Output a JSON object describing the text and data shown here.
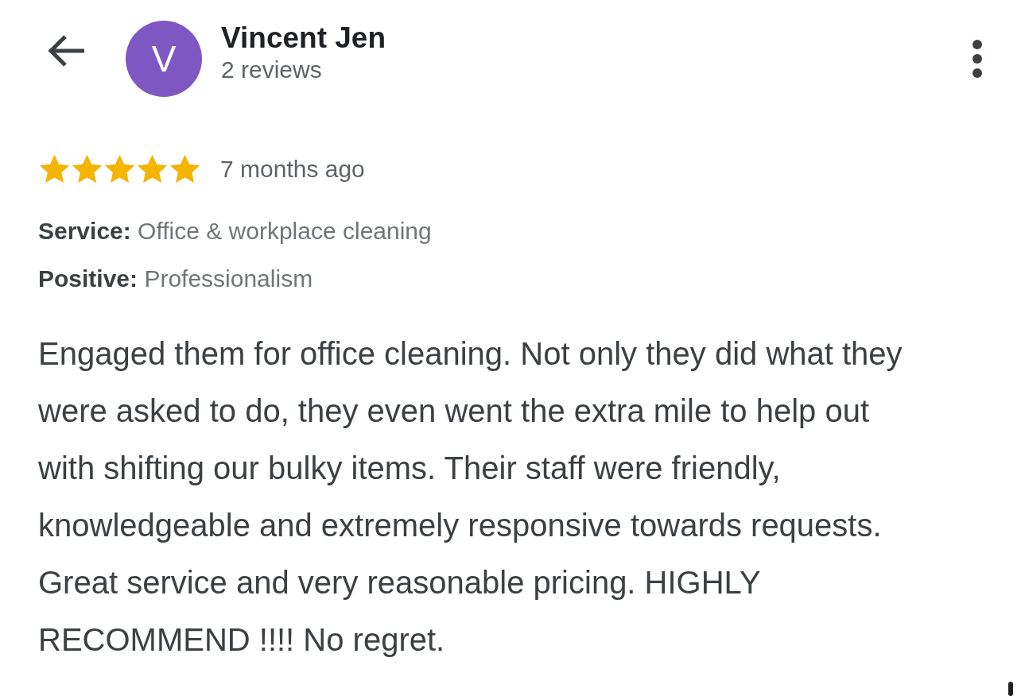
{
  "reviewer": {
    "initial": "V",
    "name": "Vincent Jen",
    "review_count": "2 reviews"
  },
  "review": {
    "stars": 5,
    "time": "7 months ago",
    "attributes": [
      {
        "label": "Service:",
        "value": "Office & workplace cleaning"
      },
      {
        "label": "Positive:",
        "value": "Professionalism"
      }
    ],
    "text": "Engaged them for office cleaning. Not only they did what they were asked to do, they even went the extra mile to help out with shifting our bulky items. Their staff were friendly, knowledgeable and extremely responsive towards requests. Great service and very reasonable pricing. HIGHLY RECOMMEND !!!! No regret."
  }
}
